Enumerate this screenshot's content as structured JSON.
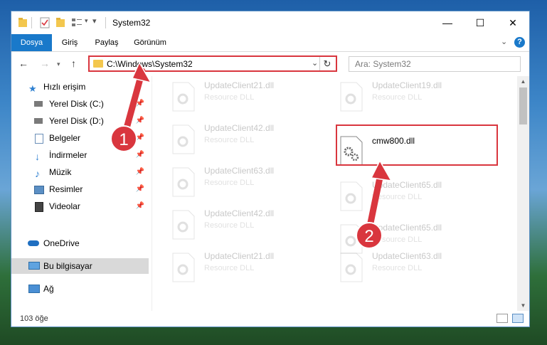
{
  "window": {
    "title": "System32",
    "controls": {
      "minimize": "—",
      "maximize": "☐",
      "close": "✕"
    }
  },
  "ribbon": {
    "tabs": [
      {
        "label": "Dosya",
        "active": true
      },
      {
        "label": "Giriş"
      },
      {
        "label": "Paylaş"
      },
      {
        "label": "Görünüm"
      }
    ],
    "expand_icon": "chevron-down-icon",
    "help_label": "?"
  },
  "nav": {
    "address": "C:\\Windows\\System32",
    "search_placeholder": "Ara: System32"
  },
  "sidebar": {
    "items": [
      {
        "label": "Hızlı erişim",
        "icon": "star-icon"
      },
      {
        "label": "Yerel Disk (C:)",
        "icon": "drive-icon",
        "pinned": true
      },
      {
        "label": "Yerel Disk (D:)",
        "icon": "drive-icon",
        "pinned": true
      },
      {
        "label": "Belgeler",
        "icon": "document-icon",
        "pinned": true
      },
      {
        "label": "İndirmeler",
        "icon": "download-icon",
        "pinned": true
      },
      {
        "label": "Müzik",
        "icon": "music-icon",
        "pinned": true
      },
      {
        "label": "Resimler",
        "icon": "pictures-icon",
        "pinned": true
      },
      {
        "label": "Videolar",
        "icon": "video-icon",
        "pinned": true
      },
      {
        "label": "OneDrive",
        "icon": "cloud-icon"
      },
      {
        "label": "Bu bilgisayar",
        "icon": "computer-icon",
        "selected": true
      },
      {
        "label": "Ağ",
        "icon": "network-icon"
      }
    ]
  },
  "files": {
    "left": [
      {
        "name": "UpdateClient21.dll",
        "type": "Resource DLL"
      },
      {
        "name": "UpdateClient42.dll",
        "type": "Resource DLL"
      },
      {
        "name": "UpdateClient63.dll",
        "type": "Resource DLL"
      },
      {
        "name": "UpdateClient42.dll",
        "type": "Resource DLL"
      },
      {
        "name": "UpdateClient21.dll",
        "type": "Resource DLL"
      }
    ],
    "right": [
      {
        "name": "UpdateClient19.dll",
        "type": "Resource DLL"
      },
      {
        "name": "cmw800.dll",
        "type": "",
        "highlighted": true
      },
      {
        "name": "UpdateClient65.dll",
        "type": "Resource DLL"
      },
      {
        "name": "UpdateClient65.dll",
        "type": "Resource DLL"
      },
      {
        "name": "UpdateClient63.dll",
        "type": "Resource DLL"
      }
    ]
  },
  "status": {
    "item_count": "103 öğe"
  },
  "annotations": {
    "marker_1": "1",
    "marker_2": "2",
    "color": "#d9363e"
  }
}
